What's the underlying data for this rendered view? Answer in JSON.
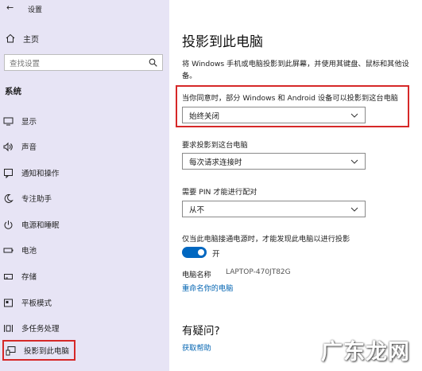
{
  "window": {
    "title": "设置"
  },
  "sidebar": {
    "home": "主页",
    "search_placeholder": "查找设置",
    "section": "系统",
    "items": [
      {
        "label": "显示",
        "icon": "display-icon"
      },
      {
        "label": "声音",
        "icon": "sound-icon"
      },
      {
        "label": "通知和操作",
        "icon": "notification-icon"
      },
      {
        "label": "专注助手",
        "icon": "moon-icon"
      },
      {
        "label": "电源和睡眠",
        "icon": "power-icon"
      },
      {
        "label": "电池",
        "icon": "battery-icon"
      },
      {
        "label": "存储",
        "icon": "storage-icon"
      },
      {
        "label": "平板模式",
        "icon": "tablet-icon"
      },
      {
        "label": "多任务处理",
        "icon": "multitask-icon"
      },
      {
        "label": "投影到此电脑",
        "icon": "project-icon"
      }
    ]
  },
  "main": {
    "title": "投影到此电脑",
    "description": "将 Windows 手机或电脑投影到此屏幕，并使用其键盘、鼠标和其他设备。",
    "setting1": {
      "label": "当你同意时，部分 Windows 和 Android 设备可以投影到这台电脑",
      "value": "始终关闭"
    },
    "setting2": {
      "label": "要求投影到这台电脑",
      "value": "每次请求连接时"
    },
    "setting3": {
      "label": "需要 PIN 才能进行配对",
      "value": "从不"
    },
    "setting4": {
      "label": "仅当此电脑接通电源时，才能发现此电脑以进行投影",
      "toggle_text": "开",
      "toggle_on": true
    },
    "pc_name_label": "电脑名称",
    "pc_name_value": "LAPTOP-470JT82G",
    "rename_link": "重命名你的电脑",
    "faq_title": "有疑问?",
    "help_link": "获取帮助"
  },
  "watermark": "广东龙网",
  "colors": {
    "sidebar_bg": "#e7e4f5",
    "accent": "#0067c0",
    "highlight": "#d62828"
  }
}
